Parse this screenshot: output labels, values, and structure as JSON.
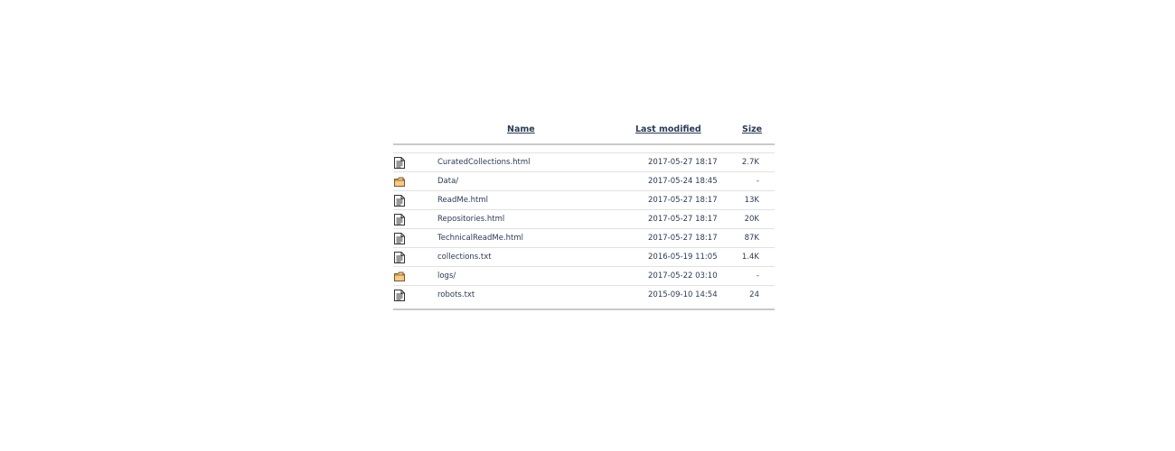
{
  "table": {
    "headers": {
      "name": "Name",
      "last_modified": "Last modified",
      "size": "Size"
    },
    "rows": [
      {
        "type": "file",
        "icon": "text-file-icon",
        "name": "CuratedCollections.html",
        "modified": "2017-05-27 18:17",
        "size": "2.7K"
      },
      {
        "type": "folder",
        "icon": "folder-icon",
        "name": "Data/",
        "modified": "2017-05-24 18:45",
        "size": "-"
      },
      {
        "type": "file",
        "icon": "text-file-icon",
        "name": "ReadMe.html",
        "modified": "2017-05-27 18:17",
        "size": "13K"
      },
      {
        "type": "file",
        "icon": "text-file-icon",
        "name": "Repositories.html",
        "modified": "2017-05-27 18:17",
        "size": "20K"
      },
      {
        "type": "file",
        "icon": "text-file-icon",
        "name": "TechnicalReadMe.html",
        "modified": "2017-05-27 18:17",
        "size": "87K"
      },
      {
        "type": "file",
        "icon": "text-file-icon",
        "name": "collections.txt",
        "modified": "2016-05-19 11:05",
        "size": "1.4K"
      },
      {
        "type": "folder",
        "icon": "folder-icon",
        "name": "logs/",
        "modified": "2017-05-22 03:10",
        "size": "-"
      },
      {
        "type": "file",
        "icon": "text-file-icon",
        "name": "robots.txt",
        "modified": "2015-09-10 14:54",
        "size": "24"
      }
    ]
  },
  "colors": {
    "text": "#2b3a55",
    "folder_fill": "#f7c98a",
    "folder_stroke": "#7a5a2a",
    "rule": "#c9c9c9"
  }
}
